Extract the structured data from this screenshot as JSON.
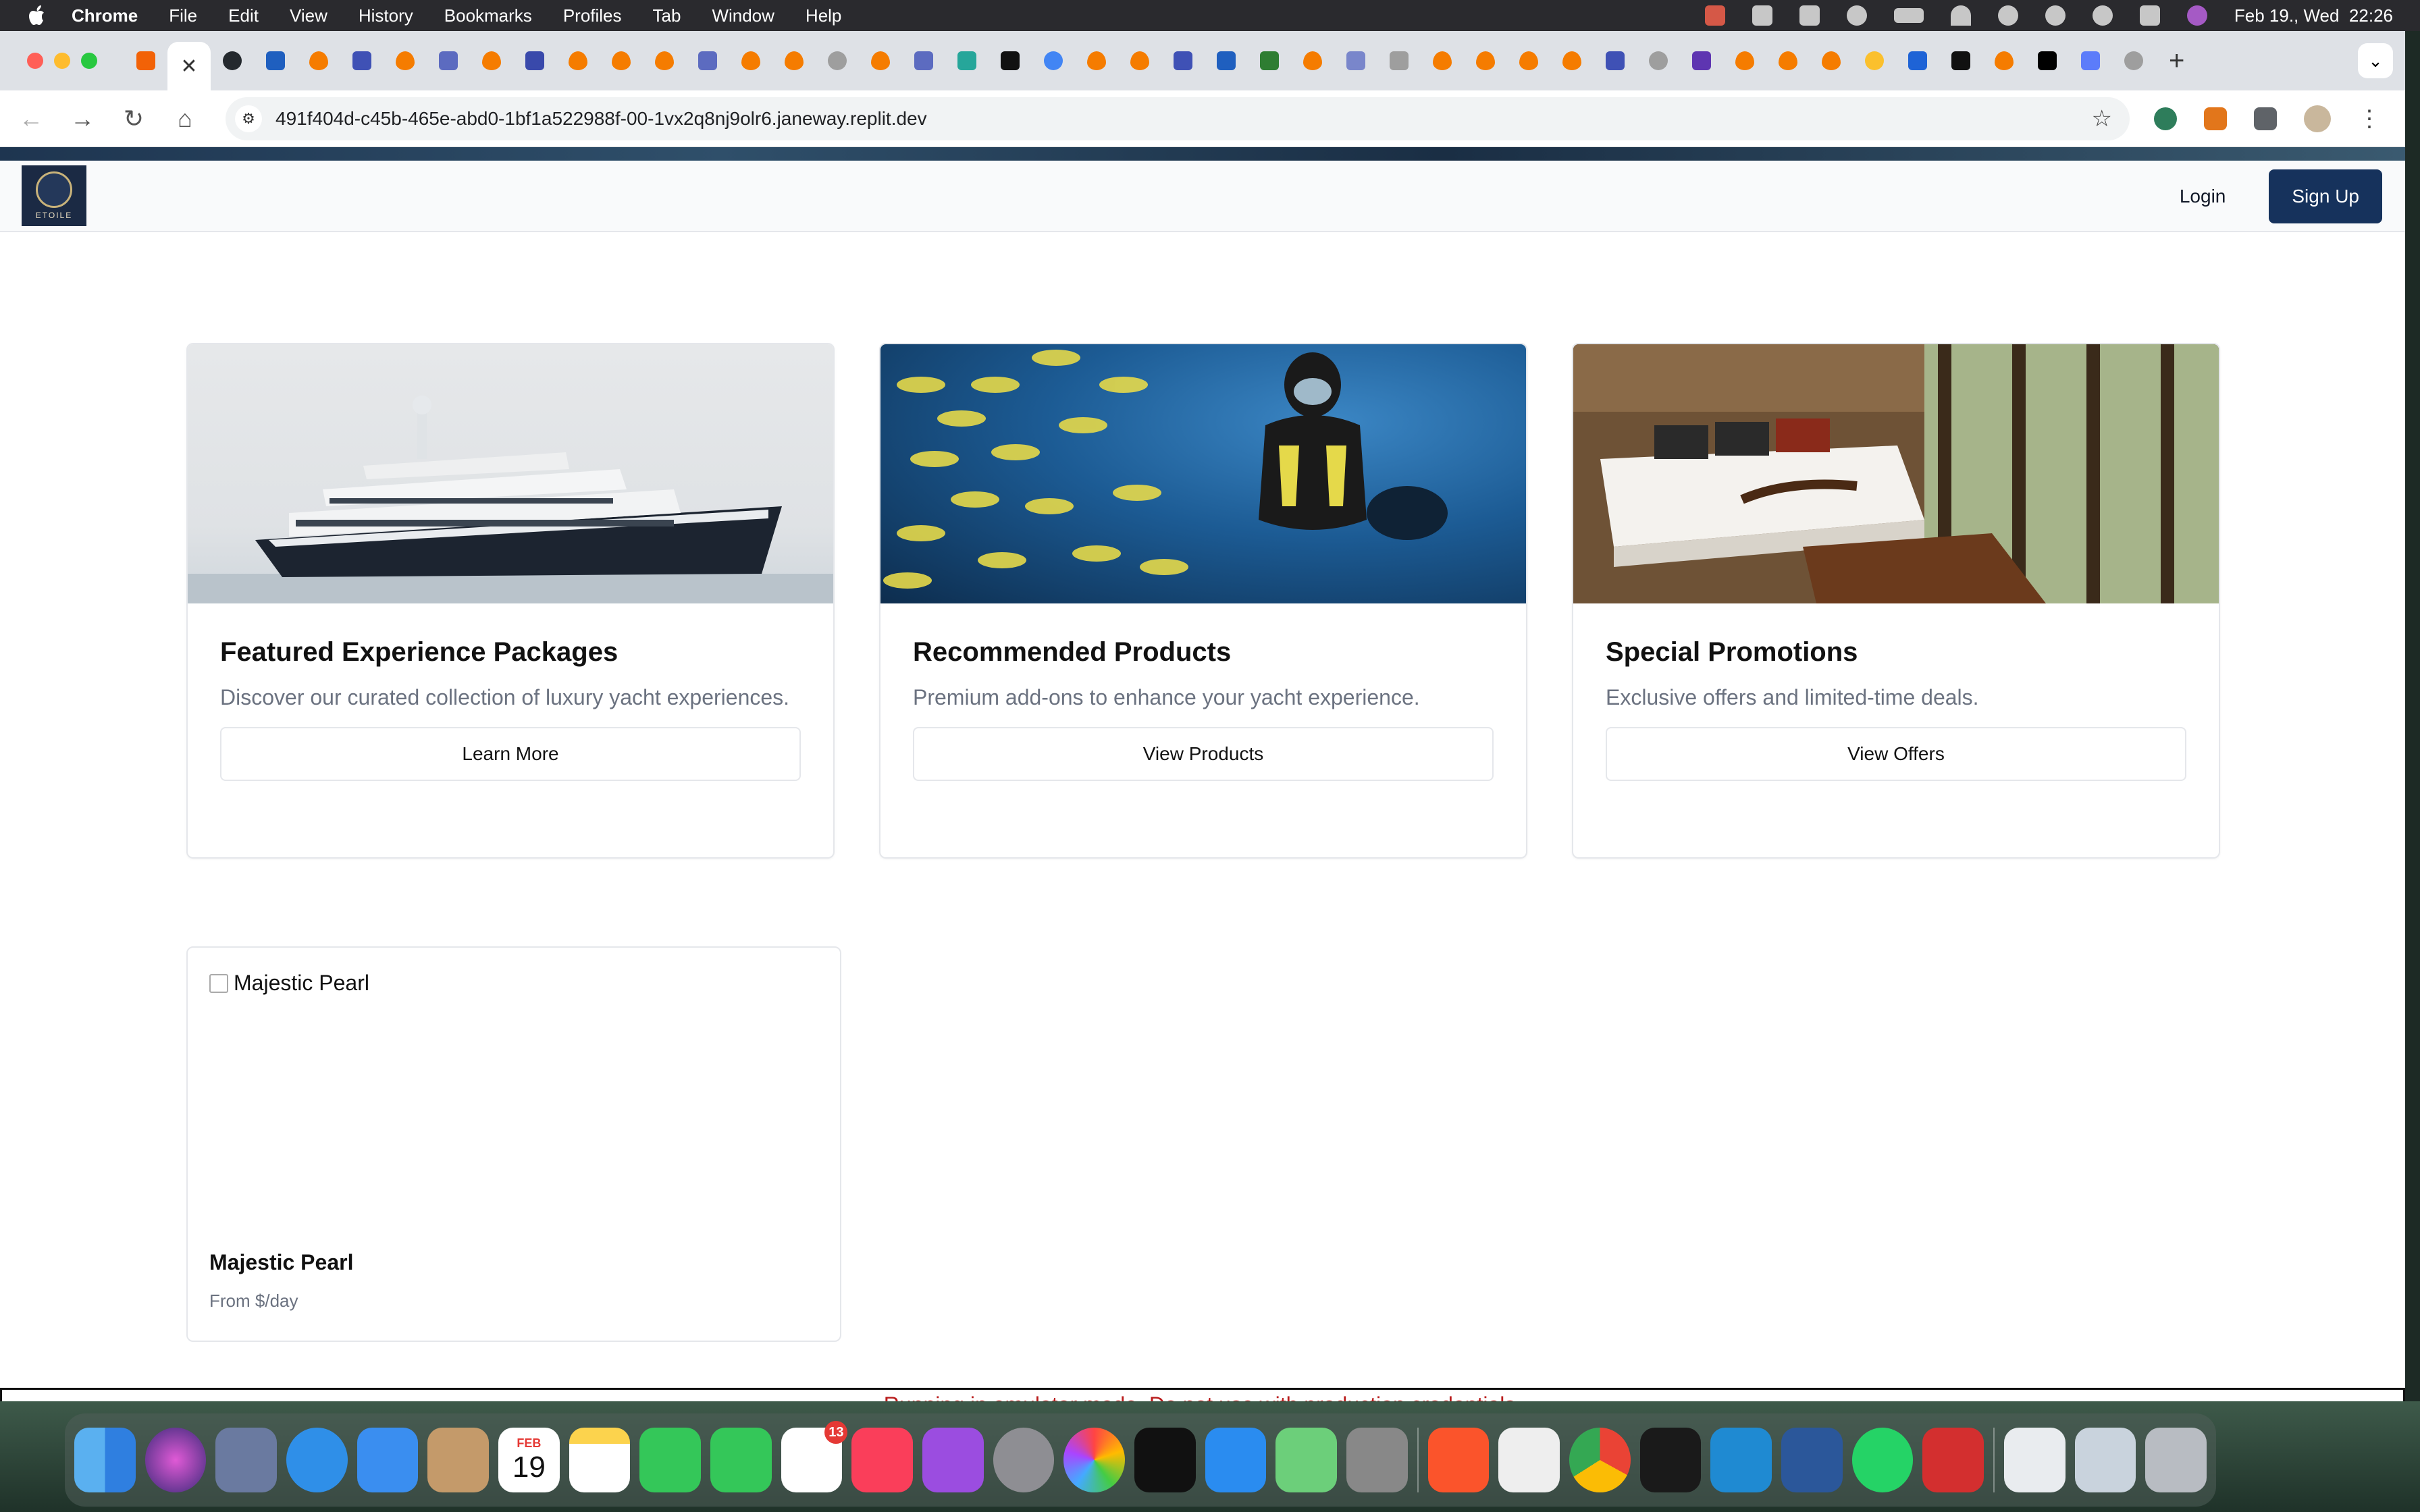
{
  "menubar": {
    "app_name": "Chrome",
    "menus": [
      "File",
      "Edit",
      "View",
      "History",
      "Bookmarks",
      "Profiles",
      "Tab",
      "Window",
      "Help"
    ],
    "clock": "Feb 19., Wed  22:26"
  },
  "browser": {
    "url": "491f404d-c45b-465e-abd0-1bf1a522988f-00-1vx2q8nj9olr6.janeway.replit.dev",
    "tab_close": "✕",
    "new_tab": "+"
  },
  "site": {
    "logo_text": "ETOILE",
    "login": "Login",
    "signup": "Sign Up"
  },
  "cards": [
    {
      "title": "Featured Experience Packages",
      "description": "Discover our curated collection of luxury yacht experiences.",
      "button": "Learn More",
      "image": "yacht"
    },
    {
      "title": "Recommended Products",
      "description": "Premium add-ons to enhance your yacht experience.",
      "button": "View Products",
      "image": "diver"
    },
    {
      "title": "Special Promotions",
      "description": "Exclusive offers and limited-time deals.",
      "button": "View Offers",
      "image": "bedroom"
    }
  ],
  "yacht_listing": {
    "image_alt": "Majestic Pearl",
    "name": "Majestic Pearl",
    "price": "From $/day"
  },
  "emulator_notice": "Running in emulator mode. Do not use with production credentials.",
  "dock": {
    "calendar_month": "FEB",
    "calendar_day": "19",
    "reminders_badge": "13"
  },
  "colors": {
    "primary": "#16325c",
    "warning_text": "#b91c1c"
  }
}
